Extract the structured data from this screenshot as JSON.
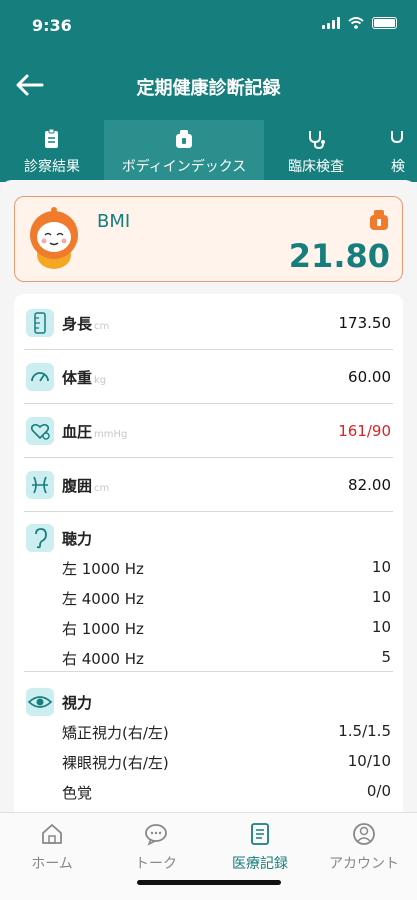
{
  "status": {
    "time": "9:36"
  },
  "header": {
    "title": "定期健康診断記録"
  },
  "tabs": [
    {
      "label": "診察結果",
      "icon": "clipboard-icon"
    },
    {
      "label": "ボディインデックス",
      "icon": "bottle-icon",
      "active": true
    },
    {
      "label": "臨床検査",
      "icon": "stethoscope-icon"
    },
    {
      "label": "検",
      "icon": "stethoscope-icon"
    }
  ],
  "bmi": {
    "label": "BMI",
    "value": "21.80"
  },
  "measurements": [
    {
      "label": "身長",
      "unit": "cm",
      "value": "173.50",
      "icon": "ruler-icon"
    },
    {
      "label": "体重",
      "unit": "kg",
      "value": "60.00",
      "icon": "scale-icon"
    },
    {
      "label": "血圧",
      "unit": "mmHg",
      "value": "161/90",
      "icon": "heart-pressure-icon",
      "alert": true
    },
    {
      "label": "腹囲",
      "unit": "cm",
      "value": "82.00",
      "icon": "waist-icon"
    }
  ],
  "hearing": {
    "label": "聴力",
    "icon": "ear-icon",
    "items": [
      {
        "label": "左 1000 Hz",
        "value": "10"
      },
      {
        "label": "左 4000 Hz",
        "value": "10"
      },
      {
        "label": "右 1000 Hz",
        "value": "10"
      },
      {
        "label": "右 4000 Hz",
        "value": "5"
      }
    ]
  },
  "vision": {
    "label": "視力",
    "icon": "eye-icon",
    "items": [
      {
        "label": "矯正視力(右/左)",
        "value": "1.5/1.5"
      },
      {
        "label": "裸眼視力(右/左)",
        "value": "10/10"
      },
      {
        "label": "色覚",
        "value": "0/0"
      }
    ]
  },
  "nav": [
    {
      "label": "ホーム",
      "icon": "home-icon"
    },
    {
      "label": "トーク",
      "icon": "chat-icon"
    },
    {
      "label": "医療記録",
      "icon": "document-icon",
      "active": true
    },
    {
      "label": "アカウント",
      "icon": "user-icon"
    }
  ],
  "colors": {
    "primary": "#167f7d",
    "alert": "#e0202a",
    "bmi_border": "#e89a72",
    "icon_bg": "#cdeef0"
  }
}
